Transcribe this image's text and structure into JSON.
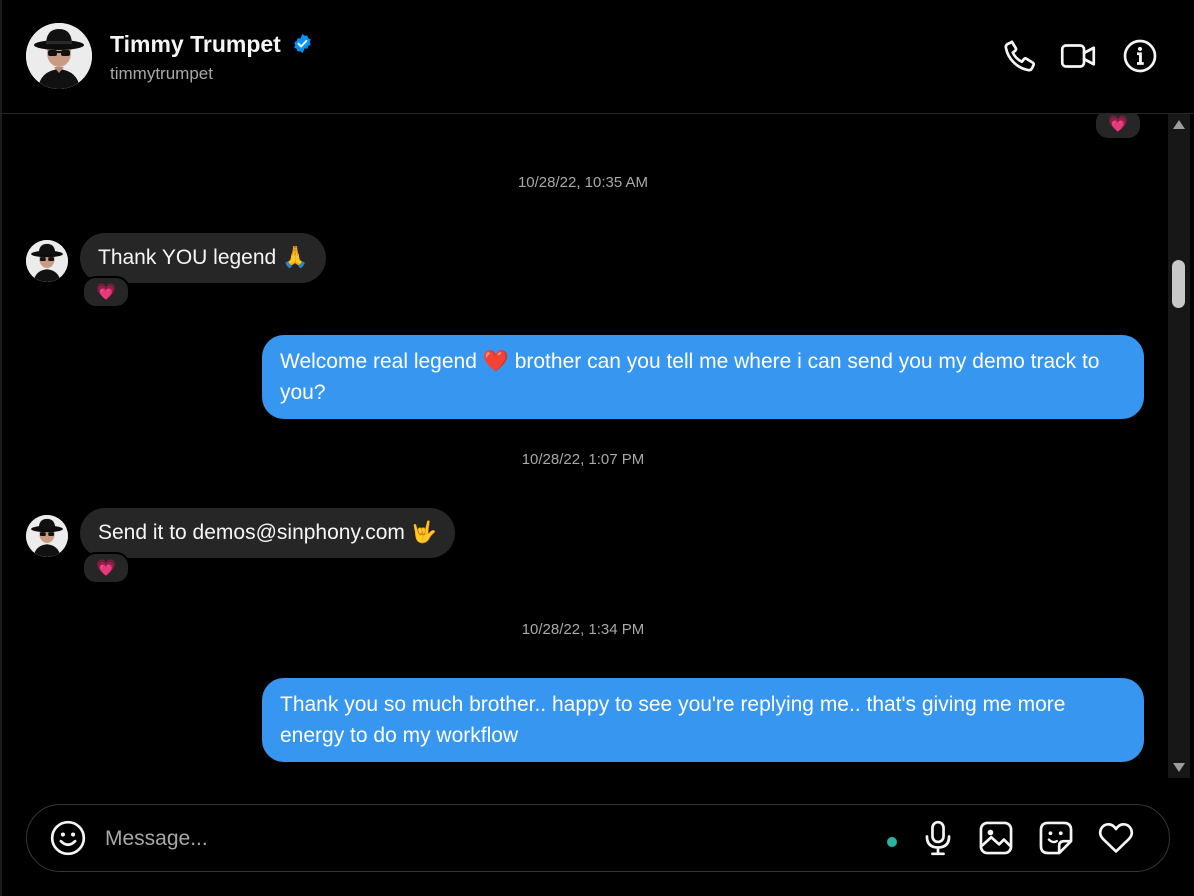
{
  "contact": {
    "name": "Timmy Trumpet",
    "handle": "timmytrumpet",
    "verified": true,
    "avatar": "avatar-hat-sunglasses"
  },
  "header_icons": [
    "phone-icon",
    "video-call-icon",
    "info-icon"
  ],
  "messages": [
    {
      "type": "reaction",
      "side": "out",
      "emoji": "💗"
    },
    {
      "type": "timestamp",
      "text": "10/28/22, 10:35 AM"
    },
    {
      "type": "message",
      "side": "in",
      "text": "Thank YOU legend 🙏",
      "reaction": "💗"
    },
    {
      "type": "message",
      "side": "out",
      "text": "Welcome real legend ❤️ brother can you tell me where i can send you my demo track to you?"
    },
    {
      "type": "timestamp",
      "text": "10/28/22, 1:07 PM"
    },
    {
      "type": "message",
      "side": "in",
      "text": "Send it to demos@sinphony.com 🤟",
      "reaction": "💗"
    },
    {
      "type": "timestamp",
      "text": "10/28/22, 1:34 PM"
    },
    {
      "type": "message",
      "side": "out",
      "text": "Thank you so much brother.. happy to see you're replying me.. that's giving me more energy to do my workflow"
    }
  ],
  "composer": {
    "placeholder": "Message...",
    "icons": [
      "emoji-icon",
      "microphone-icon",
      "image-icon",
      "sticker-icon",
      "heart-icon"
    ]
  },
  "colors": {
    "background": "#000000",
    "incoming_bubble": "#262626",
    "outgoing_bubble": "#3797f0",
    "verified_badge": "#0095f6",
    "reaction_heart": "#ff3b6b",
    "status_dot": "#2ab3a0"
  }
}
